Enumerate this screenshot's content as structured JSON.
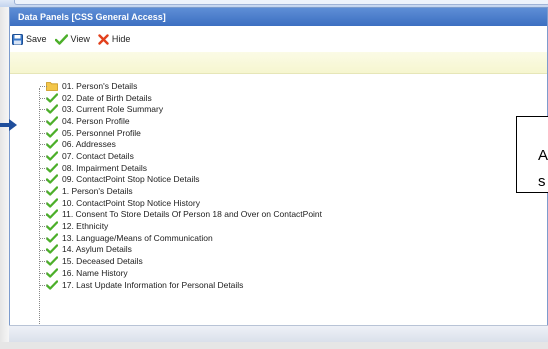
{
  "panel": {
    "title": "Data Panels [CSS General Access]"
  },
  "toolbar": {
    "save_label": "Save",
    "view_label": "View",
    "hide_label": "Hide"
  },
  "tree": {
    "items": [
      {
        "label": "01. Person's Details",
        "icon": "folder-icon"
      },
      {
        "label": "02. Date of Birth Details",
        "icon": "checkmark-icon"
      },
      {
        "label": "03. Current Role Summary",
        "icon": "checkmark-icon"
      },
      {
        "label": "04. Person Profile",
        "icon": "checkmark-icon"
      },
      {
        "label": "05. Personnel Profile",
        "icon": "checkmark-icon"
      },
      {
        "label": "06. Addresses",
        "icon": "checkmark-icon"
      },
      {
        "label": "07. Contact Details",
        "icon": "checkmark-icon"
      },
      {
        "label": "08. Impairment Details",
        "icon": "checkmark-icon"
      },
      {
        "label": "09. ContactPoint Stop Notice Details",
        "icon": "checkmark-icon"
      },
      {
        "label": "1. Person's Details",
        "icon": "checkmark-icon"
      },
      {
        "label": "10. ContactPoint Stop Notice History",
        "icon": "checkmark-icon"
      },
      {
        "label": "11. Consent To Store Details Of Person 18 and Over on ContactPoint",
        "icon": "checkmark-icon"
      },
      {
        "label": "12. Ethnicity",
        "icon": "checkmark-icon"
      },
      {
        "label": "13. Language/Means of Communication",
        "icon": "checkmark-icon"
      },
      {
        "label": "14. Asylum Details",
        "icon": "checkmark-icon"
      },
      {
        "label": "15. Deceased Details",
        "icon": "checkmark-icon"
      },
      {
        "label": "16. Name History",
        "icon": "checkmark-icon"
      },
      {
        "label": "17. Last Update Information for Personal Details",
        "icon": "checkmark-icon"
      }
    ]
  },
  "callout": {
    "line1": "A",
    "line2": "s"
  },
  "colors": {
    "titlebar": "#3c6fc1",
    "checkmark": "#4caf2a",
    "arrow": "#1f4e9c",
    "hide_x": "#e2401c"
  }
}
